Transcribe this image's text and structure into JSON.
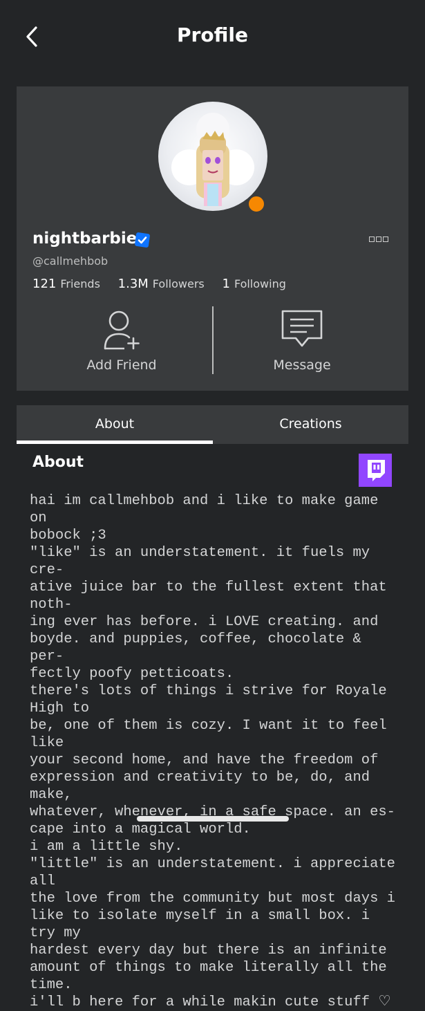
{
  "header": {
    "title": "Profile"
  },
  "profile": {
    "display_name": "nightbarbie",
    "handle": "@callmehbob",
    "stats": {
      "friends_count": "121",
      "friends_label": "Friends",
      "followers_count": "1.3M",
      "followers_label": "Followers",
      "following_count": "1",
      "following_label": "Following"
    },
    "status_color": "#f68802",
    "verified_color": "#0f74ff"
  },
  "actions": {
    "add_friend": "Add Friend",
    "message": "Message"
  },
  "tabs": [
    {
      "label": "About",
      "active": true
    },
    {
      "label": "Creations",
      "active": false
    }
  ],
  "about": {
    "title": "About",
    "social_icon": "twitch-icon",
    "bio_lines": [
      "hai im callmehbob and i like to make game on",
      "bobock ;3",
      "\"like\" is an understatement. it fuels my cre-",
      "ative juice bar to the fullest extent that noth-",
      "ing ever has before. i LOVE creating. and",
      "boyde. and puppies, coffee, chocolate & per-",
      "fectly poofy petticoats.",
      "there's lots of things i strive for Royale High to",
      "be, one of them is cozy. I want it to feel like",
      "your second home, and have the freedom of",
      "expression and creativity to be, do, and make,",
      "whatever, whenever, in a safe space. an es-",
      "cape into a magical world.",
      "i am a little shy.",
      "\"little\" is an understatement. i appreciate all",
      "the love from the community but most days i",
      "like to isolate myself in a small box. i try my",
      "hardest every day but there is an infinite",
      "amount of things to make literally all the time.",
      "i'll b here for a while makin cute stuff ♡"
    ]
  },
  "colors": {
    "background": "#232527",
    "card": "#393b3d",
    "twitch": "#9146ff"
  }
}
